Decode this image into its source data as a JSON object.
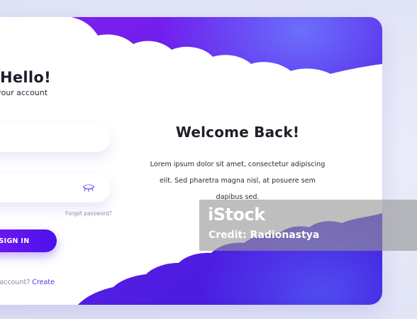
{
  "login": {
    "title": "Hello!",
    "subtitle": "n to your account",
    "email": {
      "value": "",
      "placeholder": ""
    },
    "password": {
      "value": "",
      "placeholder": ""
    },
    "forgot_password": "Forgot password?",
    "sign_in_label": "SIGN IN",
    "signup_prompt": "ve an account? ",
    "create_link": "Create"
  },
  "welcome": {
    "title": "Welcome Back!",
    "body": "Lorem ipsum dolor sit amet, consectetur adipiscing elit. Sed pharetra magna nisl, at posuere sem dapibus sed."
  },
  "watermark": {
    "brand": "iStock",
    "credit": "Credit: Radionastya"
  },
  "colors": {
    "accent_purple": "#7a1bf0",
    "accent_blue": "#4a12ea",
    "link": "#5b2de6"
  },
  "icons": {
    "password_toggle": "eye-closed-icon"
  }
}
